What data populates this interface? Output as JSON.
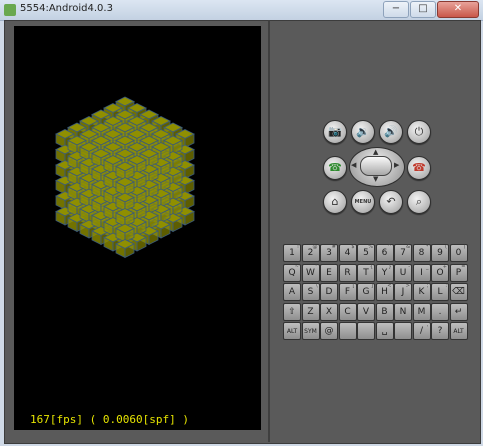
{
  "window": {
    "title": "5554:Android4.0.3",
    "minimize_label": "−",
    "maximize_label": "□",
    "close_label": "✕"
  },
  "screen": {
    "fps_text": "167[fps] ( 0.0060[spf] )",
    "cube_face_color": "#8f8f00",
    "cube_edge_color": "#3a5a7a"
  },
  "controls": {
    "camera_icon": "📷",
    "vol_down_icon": "🔉",
    "vol_up_icon": "🔊",
    "power_icon": "⏻",
    "call_icon": "☎",
    "end_call_icon": "☎",
    "home_icon": "⌂",
    "menu_label": "MENU",
    "back_icon": "↶",
    "search_icon": "⌕",
    "dpad_up": "▲",
    "dpad_down": "▼",
    "dpad_left": "◀",
    "dpad_right": "▶"
  },
  "keyboard": {
    "rows": [
      [
        [
          "1",
          "!"
        ],
        [
          "2",
          "@"
        ],
        [
          "3",
          "#"
        ],
        [
          "4",
          "$"
        ],
        [
          "5",
          "%"
        ],
        [
          "6",
          "^"
        ],
        [
          "7",
          "&"
        ],
        [
          "8",
          "*"
        ],
        [
          "9",
          "("
        ],
        [
          "0",
          ")"
        ]
      ],
      [
        [
          "Q",
          "~"
        ],
        [
          "W",
          "\""
        ],
        [
          "E",
          "´"
        ],
        [
          "R",
          ""
        ],
        [
          "T",
          "{"
        ],
        [
          "Y",
          "}"
        ],
        [
          "U",
          "-"
        ],
        [
          "I",
          "_"
        ],
        [
          "O",
          "+"
        ],
        [
          "P",
          "="
        ]
      ],
      [
        [
          "A",
          ""
        ],
        [
          "S",
          "\\"
        ],
        [
          "D",
          ""
        ],
        [
          "F",
          "["
        ],
        [
          "G",
          "]"
        ],
        [
          "H",
          "<"
        ],
        [
          "J",
          ">"
        ],
        [
          "K",
          ";"
        ],
        [
          "L",
          ":"
        ],
        [
          "⌫",
          ""
        ]
      ],
      [
        [
          "⇧",
          ""
        ],
        [
          "Z",
          ""
        ],
        [
          "X",
          ""
        ],
        [
          "C",
          ""
        ],
        [
          "V",
          ""
        ],
        [
          "B",
          ""
        ],
        [
          "N",
          ""
        ],
        [
          "M",
          ""
        ],
        [
          ".",
          ""
        ],
        [
          "↵",
          ""
        ]
      ],
      [
        [
          "ALT",
          ""
        ],
        [
          "SYM",
          ""
        ],
        [
          "@",
          ""
        ],
        [
          "",
          ""
        ],
        [
          "",
          ""
        ],
        [
          "␣",
          ""
        ],
        [
          "",
          ""
        ],
        [
          "/",
          ","
        ],
        [
          "?",
          ""
        ],
        [
          "ALT",
          ""
        ]
      ]
    ]
  }
}
